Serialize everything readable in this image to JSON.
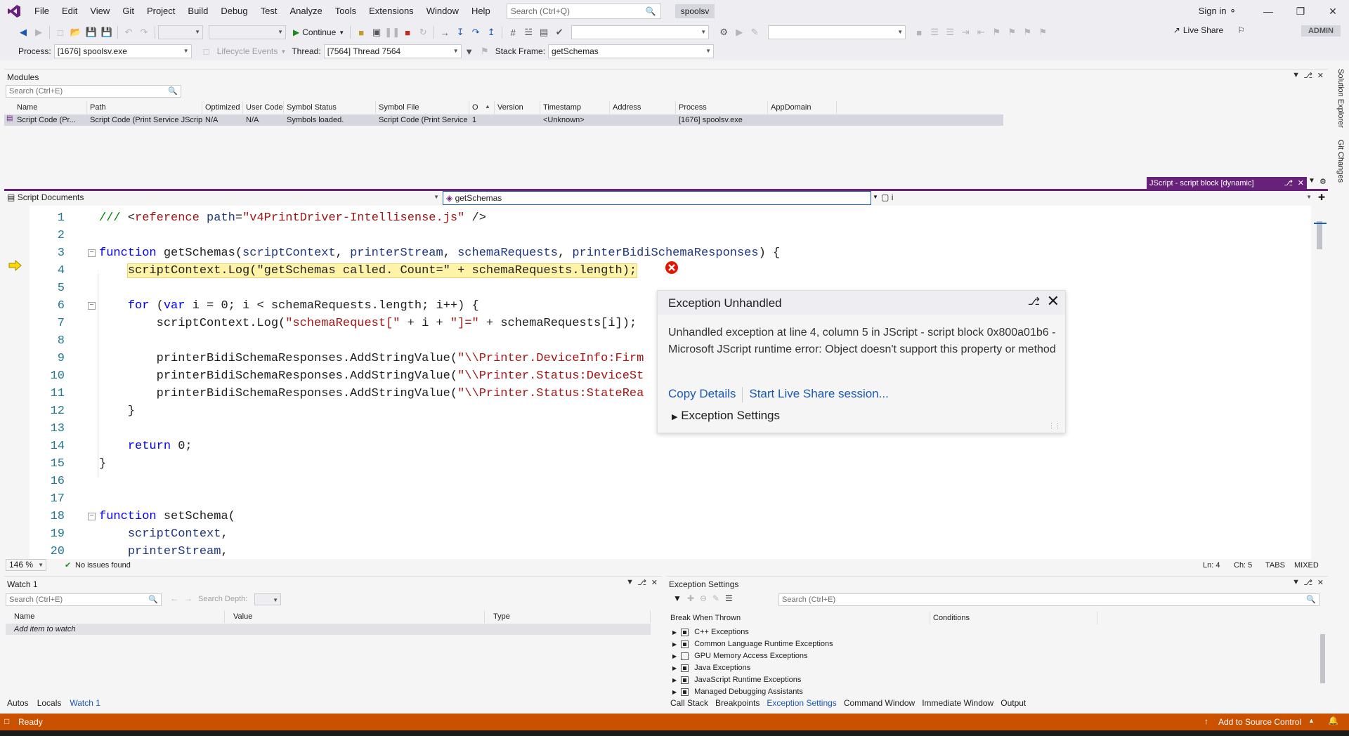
{
  "menu": {
    "items": [
      "File",
      "Edit",
      "View",
      "Git",
      "Project",
      "Build",
      "Debug",
      "Test",
      "Analyze",
      "Tools",
      "Extensions",
      "Window",
      "Help"
    ],
    "search_placeholder": "Search (Ctrl+Q)",
    "solution_name": "spoolsv",
    "sign_in": "Sign in"
  },
  "toolbar": {
    "continue_label": "Continue",
    "live_share": "Live Share",
    "admin_badge": "ADMIN"
  },
  "debug_location": {
    "process_label": "Process:",
    "process_value": "[1676] spoolsv.exe",
    "lifecycle_label": "Lifecycle Events",
    "thread_label": "Thread:",
    "thread_value": "[7564] Thread 7564",
    "stack_frame_label": "Stack Frame:",
    "stack_frame_value": "getSchemas"
  },
  "modules": {
    "title": "Modules",
    "search_placeholder": "Search (Ctrl+E)",
    "columns": [
      "Name",
      "Path",
      "Optimized",
      "User Code",
      "Symbol Status",
      "Symbol File",
      "O",
      "Version",
      "Timestamp",
      "Address",
      "Process",
      "AppDomain"
    ],
    "row": [
      "Script Code (Pr...",
      "Script Code (Print Service JScriptH...",
      "N/A",
      "N/A",
      "Symbols loaded.",
      "Script Code (Print Service ...",
      "1",
      "",
      "<Unknown>",
      "",
      "[1676] spoolsv.exe",
      ""
    ]
  },
  "side_tabs": [
    "Solution Explorer",
    "Git Changes"
  ],
  "editor": {
    "doc_tab": "JScript - script block [dynamic]",
    "nav_left": "Script Documents",
    "nav_mid": "getSchemas",
    "nav_right": "i",
    "zoom": "146 %",
    "issues": "No issues found",
    "ln": "Ln: 4",
    "ch": "Ch: 5",
    "tabs": "TABS",
    "mixed": "MIXED",
    "lines": [
      {
        "n": "1",
        "parts": [
          [
            "cm",
            "/// "
          ],
          [
            "",
            "<"
          ],
          [
            "str",
            "reference"
          ],
          [
            "",
            " "
          ],
          [
            "id",
            "path"
          ],
          [
            "",
            "="
          ],
          [
            "str",
            "\"v4PrintDriver-Intellisense.js\""
          ],
          [
            "",
            " />"
          ]
        ]
      },
      {
        "n": "2",
        "parts": []
      },
      {
        "n": "3",
        "parts": [
          [
            "kw",
            "function"
          ],
          [
            "",
            " getSchemas("
          ],
          [
            "id",
            "scriptContext"
          ],
          [
            "",
            ", "
          ],
          [
            "id",
            "printerStream"
          ],
          [
            "",
            ", "
          ],
          [
            "id",
            "schemaRequests"
          ],
          [
            "",
            ", "
          ],
          [
            "id",
            "printerBidiSchemaResponses"
          ],
          [
            "",
            ") {"
          ]
        ]
      },
      {
        "n": "4",
        "parts": [
          [
            "",
            "    "
          ],
          [
            "hl",
            "scriptContext.Log(\"getSchemas called. Count=\" + schemaRequests.length);"
          ]
        ]
      },
      {
        "n": "5",
        "parts": []
      },
      {
        "n": "6",
        "parts": [
          [
            "",
            "    "
          ],
          [
            "kw",
            "for"
          ],
          [
            "",
            " ("
          ],
          [
            "kw",
            "var"
          ],
          [
            "",
            " i = 0; i < schemaRequests.length; i++) {"
          ]
        ]
      },
      {
        "n": "7",
        "parts": [
          [
            "",
            "        scriptContext.Log("
          ],
          [
            "str",
            "\"schemaRequest[\""
          ],
          [
            "",
            " + i + "
          ],
          [
            "str",
            "\"]=\""
          ],
          [
            "",
            " + schemaRequests[i]);"
          ]
        ]
      },
      {
        "n": "8",
        "parts": []
      },
      {
        "n": "9",
        "parts": [
          [
            "",
            "        printerBidiSchemaResponses.AddStringValue("
          ],
          [
            "str",
            "\"\\\\Printer.DeviceInfo:Firm"
          ]
        ]
      },
      {
        "n": "10",
        "parts": [
          [
            "",
            "        printerBidiSchemaResponses.AddStringValue("
          ],
          [
            "str",
            "\"\\\\Printer.Status:DeviceSt"
          ]
        ]
      },
      {
        "n": "11",
        "parts": [
          [
            "",
            "        printerBidiSchemaResponses.AddStringValue("
          ],
          [
            "str",
            "\"\\\\Printer.Status:StateRea"
          ]
        ]
      },
      {
        "n": "12",
        "parts": [
          [
            "",
            "    }"
          ]
        ]
      },
      {
        "n": "13",
        "parts": []
      },
      {
        "n": "14",
        "parts": [
          [
            "",
            "    "
          ],
          [
            "kw",
            "return"
          ],
          [
            "",
            " 0;"
          ]
        ]
      },
      {
        "n": "15",
        "parts": [
          [
            "",
            "}"
          ]
        ]
      },
      {
        "n": "16",
        "parts": []
      },
      {
        "n": "17",
        "parts": []
      },
      {
        "n": "18",
        "parts": [
          [
            "kw",
            "function"
          ],
          [
            "",
            " setSchema("
          ]
        ]
      },
      {
        "n": "19",
        "parts": [
          [
            "",
            "    "
          ],
          [
            "id",
            "scriptContext"
          ],
          [
            "",
            ","
          ]
        ]
      },
      {
        "n": "20",
        "parts": [
          [
            "",
            "    "
          ],
          [
            "id",
            "printerStream"
          ],
          [
            "",
            ","
          ]
        ]
      }
    ]
  },
  "exception": {
    "title": "Exception Unhandled",
    "message": "Unhandled exception at line 4, column 5 in JScript - script block 0x800a01b6 - Microsoft JScript runtime error: Object doesn't support this property or method",
    "copy_details": "Copy Details",
    "live_share": "Start Live Share session...",
    "settings": "Exception Settings"
  },
  "watch": {
    "title": "Watch 1",
    "search_placeholder": "Search (Ctrl+E)",
    "search_depth": "Search Depth:",
    "columns": [
      "Name",
      "Value",
      "Type"
    ],
    "add_item": "Add item to watch",
    "tabs": [
      "Autos",
      "Locals",
      "Watch 1"
    ]
  },
  "exception_settings": {
    "title": "Exception Settings",
    "search_placeholder": "Search (Ctrl+E)",
    "col_break": "Break When Thrown",
    "col_conditions": "Conditions",
    "items": [
      {
        "label": "C++ Exceptions",
        "state": "partial"
      },
      {
        "label": "Common Language Runtime Exceptions",
        "state": "partial"
      },
      {
        "label": "GPU Memory Access Exceptions",
        "state": "none"
      },
      {
        "label": "Java Exceptions",
        "state": "partial"
      },
      {
        "label": "JavaScript Runtime Exceptions",
        "state": "partial"
      },
      {
        "label": "Managed Debugging Assistants",
        "state": "partial"
      }
    ],
    "tabs": [
      "Call Stack",
      "Breakpoints",
      "Exception Settings",
      "Command Window",
      "Immediate Window",
      "Output"
    ]
  },
  "status": {
    "ready": "Ready",
    "source_control": "Add to Source Control"
  },
  "colors": {
    "accent": "#68217a",
    "status_bar": "#ca5100",
    "link": "#1a59b5",
    "error": "#e51400"
  }
}
